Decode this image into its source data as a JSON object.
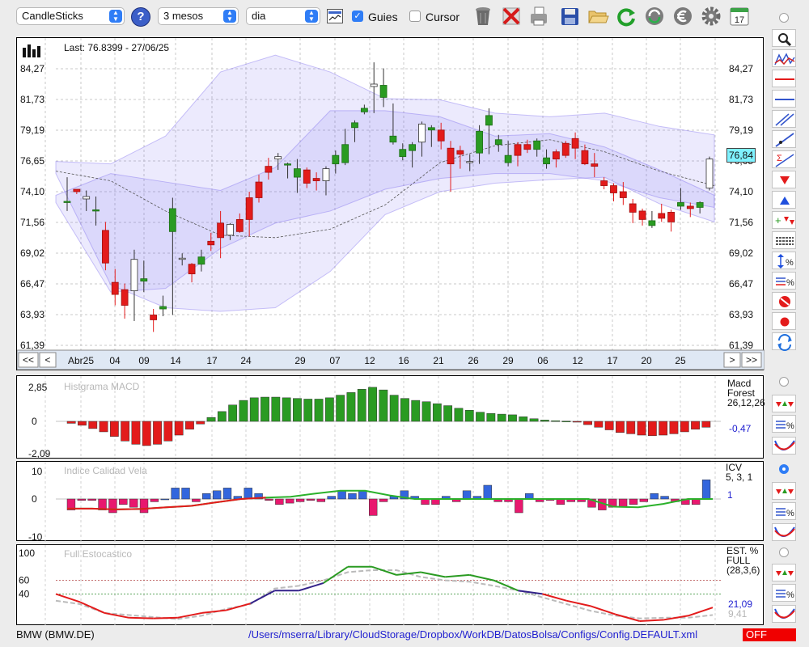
{
  "toolbar": {
    "chart_type": "CandleSticks",
    "help": "?",
    "period": "3 mesos",
    "interval": "dia",
    "guides_label": "Guies",
    "guides_checked": true,
    "cursor_label": "Cursor",
    "cursor_checked": false,
    "calendar_day": "17"
  },
  "price_panel": {
    "last_label": "Last: 76.8399 - 27/06/25",
    "price_ticks": [
      "84,27",
      "81,73",
      "79,19",
      "76,65",
      "74,10",
      "71,56",
      "69,02",
      "66,47",
      "63,93",
      "61,39"
    ],
    "current_price": "76,84",
    "nav": {
      "first": "<<",
      "prev": "<",
      "next": ">",
      "last": ">>"
    },
    "date_labels": [
      "Abr25",
      "04",
      "09",
      "14",
      "17",
      "24",
      "29",
      "07",
      "12",
      "16",
      "21",
      "26",
      "29",
      "06",
      "12",
      "17",
      "20",
      "25"
    ]
  },
  "macd_panel": {
    "watermark": "Histgrama MACD",
    "ticks": [
      "2,85",
      "0",
      "-2,09"
    ],
    "name": "Macd",
    "name2": "Forest",
    "params": "26,12,26",
    "value": "-0,47"
  },
  "icv_panel": {
    "watermark": "Indice Calidad Vela",
    "ticks": [
      "10",
      "0",
      "-10"
    ],
    "name": "ICV",
    "params": "5, 3, 1",
    "value": "1"
  },
  "stoch_panel": {
    "watermark": "Full Estocastico",
    "ticks": [
      "100",
      "60",
      "40",
      "0"
    ],
    "name": "EST. %",
    "name2": "FULL",
    "params": "(28,3,6)",
    "value_k": "21,09",
    "value_d": "9,41"
  },
  "status": {
    "symbol": "BMW (BMW.DE)",
    "config_path": "/Users/mserra/Library/CloudStorage/Dropbox/WorkDB/DatosBolsa/Configs/Config.DEFAULT.xml",
    "live": "OFF"
  },
  "colors": {
    "up": "#2a9b22",
    "down": "#e31b1b",
    "band": "#7b68ee",
    "select_accent": "#2f7df6",
    "value_blue": "#1f1fd0",
    "off_red": "#f00000"
  },
  "icons": [
    "search-icon",
    "trash-icon",
    "delete-icon",
    "printer-icon",
    "save-icon",
    "open-folder-icon",
    "refresh-icon",
    "sync-icon",
    "currency-icon",
    "gear-icon",
    "calendar-icon"
  ],
  "chart_data": [
    {
      "type": "candlestick",
      "title": "",
      "ylim": [
        61.39,
        86.0
      ],
      "candles": [
        [
          73.3,
          73.3,
          75.3,
          72.5
        ],
        [
          74.3,
          74.1,
          74.3,
          73.9
        ],
        [
          73.5,
          73.7,
          74.2,
          72.5
        ],
        [
          72.5,
          72.6,
          73.7,
          71.3
        ],
        [
          70.9,
          68.2,
          71.6,
          67.6
        ],
        [
          66.6,
          65.6,
          67.7,
          64.7
        ],
        [
          66.0,
          64.7,
          66.5,
          63.6
        ],
        [
          65.9,
          68.5,
          69.3,
          63.4
        ],
        [
          66.7,
          66.9,
          68.4,
          65.8
        ],
        [
          63.9,
          63.5,
          64.4,
          62.5
        ],
        [
          64.4,
          64.6,
          65.5,
          63.8
        ],
        [
          70.8,
          72.7,
          73.6,
          63.9
        ],
        [
          68.5,
          68.6,
          69.0,
          68.0
        ],
        [
          68.1,
          67.3,
          68.2,
          66.6
        ],
        [
          68.1,
          68.7,
          69.3,
          67.5
        ],
        [
          70.0,
          69.7,
          70.7,
          69.2
        ],
        [
          71.5,
          70.3,
          72.5,
          68.6
        ],
        [
          70.5,
          71.4,
          71.5,
          70.1
        ],
        [
          71.8,
          70.8,
          72.3,
          70.7
        ],
        [
          73.6,
          71.8,
          74.1,
          70.4
        ],
        [
          74.9,
          73.6,
          75.5,
          73.2
        ],
        [
          76.2,
          75.7,
          76.9,
          75.1
        ],
        [
          76.8,
          77.0,
          77.3,
          75.9
        ],
        [
          76.3,
          76.4,
          76.5,
          75.2
        ],
        [
          75.3,
          76.0,
          76.8,
          74.0
        ],
        [
          75.9,
          74.8,
          76.1,
          74.4
        ],
        [
          75.2,
          75.0,
          75.7,
          74.2
        ],
        [
          75.0,
          76.0,
          76.2,
          73.8
        ],
        [
          76.4,
          77.1,
          77.5,
          75.6
        ],
        [
          76.5,
          78.0,
          79.3,
          76.3
        ],
        [
          79.4,
          79.8,
          80.0,
          78.2
        ],
        [
          80.7,
          81.0,
          81.3,
          80.5
        ],
        [
          82.8,
          83.0,
          84.8,
          80.6
        ],
        [
          81.9,
          82.9,
          84.3,
          81.1
        ],
        [
          78.2,
          78.7,
          81.4,
          78.0
        ],
        [
          77.0,
          77.6,
          78.1,
          76.7
        ],
        [
          77.5,
          78.0,
          78.2,
          76.1
        ],
        [
          78.2,
          79.7,
          79.9,
          77.0
        ],
        [
          79.2,
          79.4,
          79.6,
          77.8
        ],
        [
          79.2,
          78.3,
          79.8,
          77.6
        ],
        [
          77.7,
          76.4,
          78.3,
          74.1
        ],
        [
          77.5,
          77.2,
          77.9,
          76.0
        ],
        [
          76.5,
          76.6,
          77.2,
          75.8
        ],
        [
          77.3,
          79.1,
          79.6,
          76.4
        ],
        [
          79.6,
          80.4,
          81.0,
          77.2
        ],
        [
          78.0,
          78.4,
          78.8,
          77.4
        ],
        [
          76.5,
          77.1,
          78.3,
          76.2
        ],
        [
          78.0,
          77.1,
          78.2,
          76.2
        ],
        [
          78.0,
          77.6,
          78.4,
          77.3
        ],
        [
          77.6,
          78.3,
          78.5,
          77.0
        ],
        [
          76.4,
          76.9,
          77.6,
          76.0
        ],
        [
          77.4,
          76.8,
          77.6,
          76.1
        ],
        [
          78.1,
          77.1,
          78.3,
          76.9
        ],
        [
          78.5,
          77.7,
          79.0,
          76.8
        ],
        [
          77.5,
          76.4,
          78.0,
          76.3
        ],
        [
          76.4,
          76.2,
          77.3,
          75.3
        ],
        [
          75.0,
          74.6,
          75.3,
          74.3
        ],
        [
          74.6,
          74.0,
          74.8,
          73.3
        ],
        [
          74.1,
          73.6,
          74.9,
          73.0
        ],
        [
          73.1,
          72.4,
          73.5,
          71.5
        ],
        [
          72.5,
          71.8,
          72.7,
          71.3
        ],
        [
          71.3,
          71.7,
          72.5,
          71.1
        ],
        [
          72.3,
          71.9,
          73.1,
          71.6
        ],
        [
          72.4,
          71.6,
          72.6,
          70.8
        ],
        [
          72.9,
          73.2,
          74.4,
          72.6
        ],
        [
          72.9,
          72.7,
          73.2,
          72.0
        ],
        [
          72.8,
          73.2,
          73.3,
          72.3
        ],
        [
          74.4,
          76.8,
          77.0,
          74.2
        ]
      ],
      "band_upper": [
        76.6,
        76.4,
        78.7,
        84.0,
        85.4,
        84.0,
        81.8,
        81.7,
        80.6,
        80.3,
        80.6,
        79.5,
        78.8
      ],
      "band_lower": [
        75.6,
        66.4,
        64.5,
        64.2,
        64.5,
        67.5,
        72.2,
        74.1,
        74.8,
        75.1,
        75.3,
        73.1,
        71.6
      ],
      "inner_upper": [
        73.8,
        75.6,
        74.9,
        74.2,
        76.1,
        80.8,
        80.8,
        80.3,
        78.7,
        78.9,
        77.8,
        75.9,
        73.8
      ],
      "inner_lower": [
        73.2,
        65.8,
        66.1,
        69.4,
        71.5,
        72.5,
        74.3,
        75.2,
        75.6,
        75.6,
        75.0,
        73.6,
        72.8
      ],
      "mid_line": [
        75.8,
        75.0,
        72.5,
        70.5,
        70.3,
        71.0,
        73.0,
        76.5,
        77.9,
        78.4,
        77.4,
        75.8,
        74.6
      ]
    },
    {
      "type": "bar",
      "title": "Histgrama MACD",
      "ylim": [
        -2.09,
        2.85
      ],
      "values": [
        -0.15,
        -0.3,
        -0.55,
        -0.8,
        -1.15,
        -1.5,
        -1.75,
        -1.85,
        -1.75,
        -1.5,
        -1.05,
        -0.6,
        -0.2,
        0.3,
        0.75,
        1.25,
        1.6,
        1.8,
        1.85,
        1.85,
        1.8,
        1.75,
        1.7,
        1.7,
        1.8,
        2.0,
        2.2,
        2.45,
        2.6,
        2.4,
        2.0,
        1.75,
        1.6,
        1.5,
        1.35,
        1.2,
        1.0,
        0.85,
        0.7,
        0.6,
        0.55,
        0.5,
        0.35,
        0.2,
        0.1,
        0.05,
        0.02,
        -0.05,
        -0.25,
        -0.45,
        -0.65,
        -0.85,
        -0.95,
        -1.05,
        -1.1,
        -1.05,
        -0.95,
        -0.8,
        -0.6,
        -0.45
      ]
    },
    {
      "type": "bar",
      "title": "Indice Calidad Vela",
      "ylim": [
        -10,
        10
      ],
      "values": [
        -4,
        -0.5,
        -0.5,
        -4,
        -5,
        -2,
        -3,
        -5,
        -1,
        0,
        4,
        4,
        -1,
        2,
        3,
        4,
        1,
        4,
        2,
        -0.5,
        -2,
        -1.5,
        -1,
        -0.5,
        -1,
        1,
        3,
        2,
        3,
        -6,
        -1,
        1,
        3,
        1,
        -2,
        -2,
        1,
        -1,
        3,
        1,
        5,
        -1,
        -1,
        -5,
        2,
        -1,
        -0.5,
        -2,
        -1,
        -1,
        -3,
        -4,
        -3,
        -3,
        -2,
        -1,
        2,
        1,
        -1,
        -2,
        -2,
        7
      ],
      "line": [
        -3.5,
        -3.5,
        -3.8,
        -3.6,
        -3.0,
        -2.5,
        -1.2,
        0.0,
        0.5,
        0.8,
        2.0,
        3.0,
        3.0,
        1.3,
        0.0,
        0.0,
        0.0,
        0.0,
        0.0,
        0.0,
        0.0,
        0.0,
        -2.8,
        -3.0,
        -1.8,
        0.0,
        0.0
      ]
    },
    {
      "type": "line",
      "title": "Full Estocastico",
      "ylim": [
        0,
        100
      ],
      "series": [
        {
          "values": [
            40,
            28,
            12,
            5,
            4,
            5,
            12,
            16,
            26,
            45,
            45,
            56,
            80,
            80,
            68,
            72,
            65,
            68,
            60,
            45,
            40,
            30,
            22,
            10,
            0,
            2,
            8,
            20
          ]
        },
        {
          "values": [
            30,
            25,
            12,
            9,
            6,
            3,
            8,
            18,
            25,
            48,
            52,
            60,
            72,
            75,
            75,
            65,
            60,
            58,
            52,
            45,
            35,
            25,
            15,
            8,
            4,
            5,
            5,
            9
          ]
        }
      ]
    }
  ]
}
